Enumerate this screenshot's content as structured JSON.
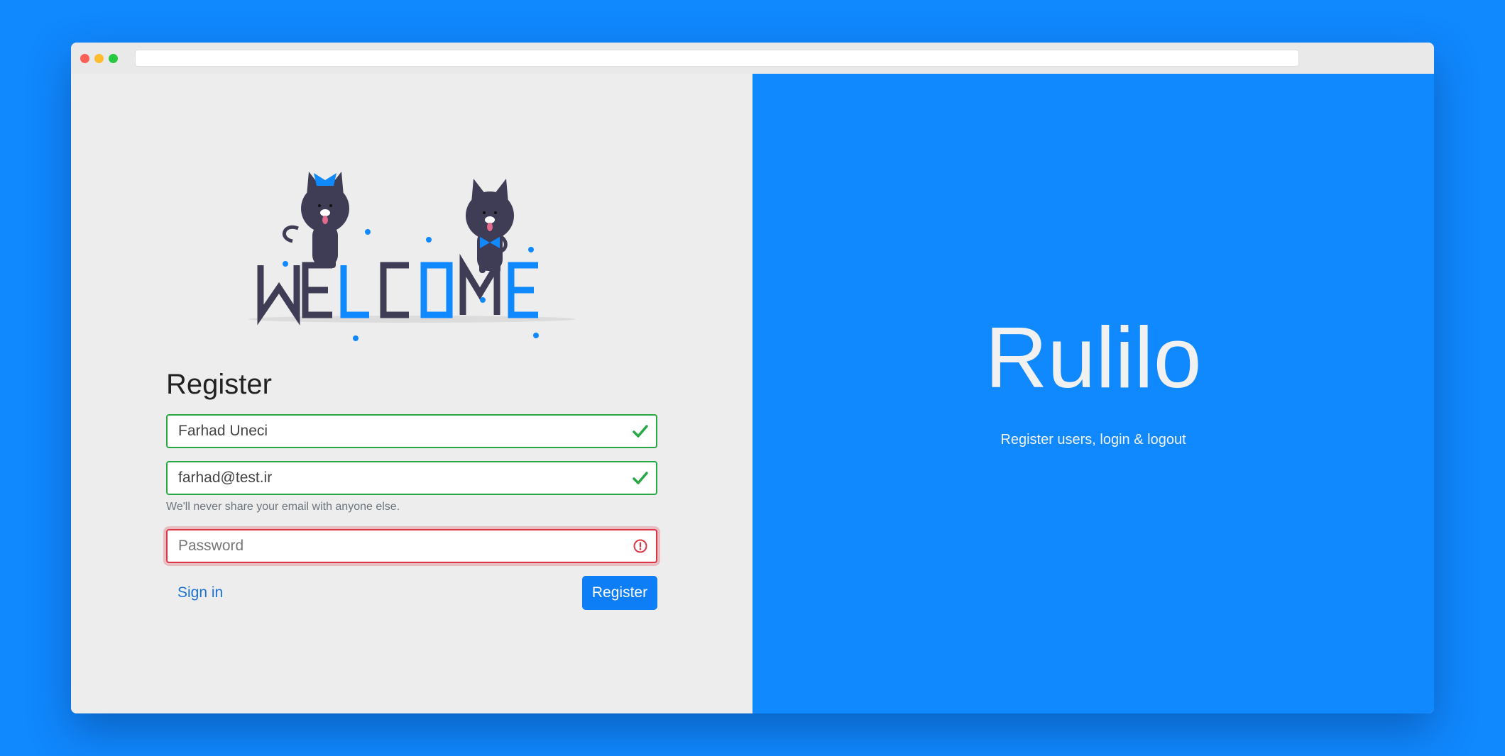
{
  "colors": {
    "background": "#1088fe",
    "panel": "#ededed",
    "accent": "#0d7ef5",
    "valid": "#28a745",
    "invalid": "#dc3545",
    "illustration_dark": "#3f3d56"
  },
  "illustration": {
    "welcome_letters": [
      "W",
      "E",
      "L",
      "C",
      "O",
      "M",
      "E"
    ],
    "icon": "welcome-cats-illustration"
  },
  "register": {
    "title": "Register",
    "name": {
      "value": "Farhad Uneci",
      "status": "valid",
      "icon": "check-icon"
    },
    "email": {
      "value": "farhad@test.ir",
      "status": "valid",
      "icon": "check-icon",
      "help": "We'll never share your email with anyone else."
    },
    "password": {
      "value": "",
      "placeholder": "Password",
      "status": "invalid",
      "icon": "error-icon"
    },
    "signin_label": "Sign in",
    "submit_label": "Register"
  },
  "hero": {
    "brand": "Rulilo",
    "tagline": "Register users, login & logout"
  }
}
